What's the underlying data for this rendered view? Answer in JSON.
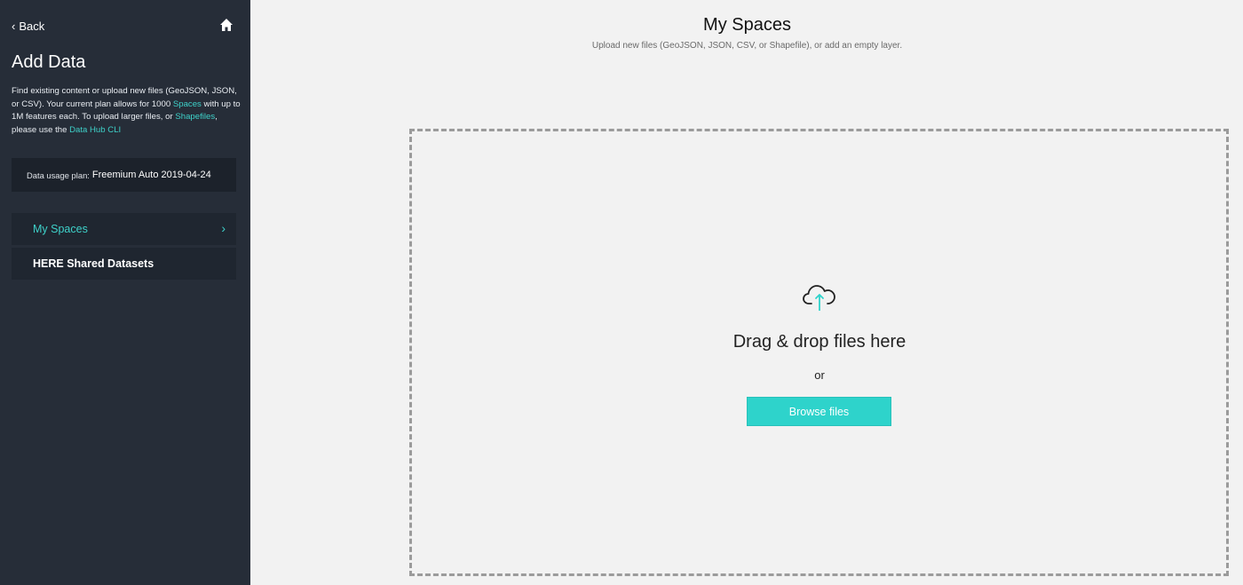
{
  "sidebar": {
    "back_label": "Back",
    "title": "Add Data",
    "description": {
      "part1": "Find existing content or upload new files (GeoJSON, JSON, or CSV). Your current plan allows for 1000 ",
      "link_spaces": "Spaces",
      "part2": " with up to 1M features each. To upload larger files, or ",
      "link_shapefiles": "Shapefiles",
      "part3": ", please use the ",
      "link_cli": "Data Hub CLI"
    },
    "plan_label": "Data usage plan:",
    "plan_value": "Freemium Auto 2019-04-24",
    "nav": [
      {
        "label": "My Spaces",
        "active": true
      },
      {
        "label": "HERE Shared Datasets",
        "active": false
      }
    ]
  },
  "main": {
    "title": "My Spaces",
    "subtitle": "Upload new files (GeoJSON, JSON, CSV, or Shapefile), or add an empty layer.",
    "drop_text": "Drag & drop files here",
    "or_text": "or",
    "browse_label": "Browse files"
  },
  "colors": {
    "accent": "#3ed1c9",
    "sidebar_bg": "#262d38",
    "button_bg": "#2ed3cb"
  },
  "icons": [
    "chevron-left-icon",
    "home-icon",
    "chevron-right-icon",
    "cloud-upload-icon"
  ]
}
